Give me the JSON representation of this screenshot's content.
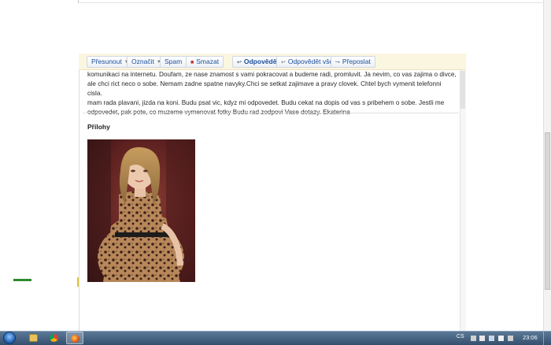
{
  "toolbar": {
    "move_label": "Přesunout",
    "mark_label": "Označit",
    "spam_label": "Spam",
    "delete_label": "Smazat",
    "reply_label": "Odpovědět",
    "reply_all_label": "Odpovědět všem",
    "forward_label": "Přeposlat"
  },
  "message": {
    "body_line_1": "komunikaci na internetu. Doufam, ze nase znamost s vami pokracovat a budeme radi, promluvit. Ja nevim, co vas zajima o divce,",
    "body_line_2": "ale chci rict neco o sobe. Nemam zadne spatne navyky.Chci se setkat zajimave a pravy clovek. Chtel bych vymenit telefonni cisla.",
    "body_line_3": "mam rada plavani, jizda na koni. Budu psat vic, kdyz mi odpovedet. Budu cekat na dopis od vas s pribehem o sobe. Jestli me",
    "body_line_4": "odpovedet, pak pote, co muzeme vymenovat fotky Budu rad zodpovi Vase dotazy. Ekaterina",
    "attachments_title": "Přílohy"
  },
  "taskbar": {
    "language": "CS",
    "clock": "23:06",
    "items": [
      "windows-explorer",
      "chrome",
      "firefox"
    ]
  },
  "colors": {
    "toolbar_bg": "#fbf6e0",
    "link_blue": "#1b4f9c",
    "taskbar": "#3f5c7b"
  }
}
